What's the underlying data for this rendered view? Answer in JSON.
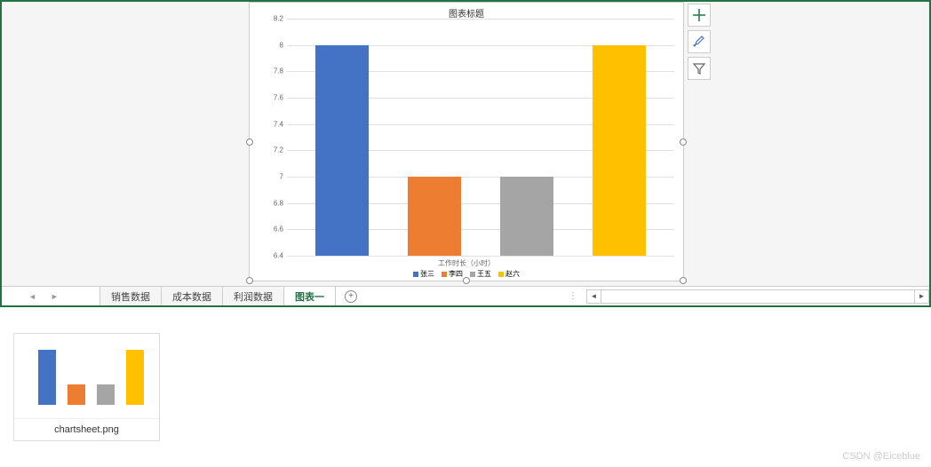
{
  "chart_data": {
    "type": "bar",
    "title": "图表标题",
    "categories": [
      "张三",
      "李四",
      "王五",
      "赵六"
    ],
    "values": [
      8.0,
      7.0,
      7.0,
      8.0
    ],
    "xlabel": "工作时长（小时）",
    "ylabel": "",
    "ylim": [
      6.4,
      8.2
    ],
    "yticks": [
      6.4,
      6.6,
      6.8,
      7,
      7.2,
      7.4,
      7.6,
      7.8,
      8,
      8.2
    ],
    "colors": [
      "#4472c4",
      "#ed7d31",
      "#a5a5a5",
      "#ffc000"
    ]
  },
  "tabs": {
    "items": [
      "销售数据",
      "成本数据",
      "利润数据",
      "图表一"
    ],
    "active_index": 3
  },
  "side_buttons": {
    "plus": "plus-icon",
    "brush": "brush-icon",
    "filter": "filter-icon"
  },
  "thumbnail": {
    "filename": "chartsheet.png"
  },
  "watermark": "CSDN @Eiceblue"
}
